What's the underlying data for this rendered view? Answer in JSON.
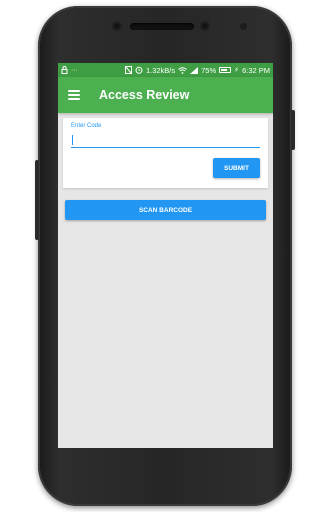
{
  "status_bar": {
    "lock_icon": "lock-icon",
    "dots": "···",
    "net_speed": "1.32kB/s",
    "battery_percent": "75%",
    "time": "6:32 PM"
  },
  "app_bar": {
    "title": "Access Review"
  },
  "form": {
    "code_label": "Enter Code",
    "code_value": "",
    "submit_label": "SUBMIT"
  },
  "scan": {
    "label": "SCAN BARCODE"
  },
  "colors": {
    "status_bar": "#3f9e44",
    "app_bar": "#4caf50",
    "accent": "#2196f3",
    "background": "#e6e6e6"
  }
}
